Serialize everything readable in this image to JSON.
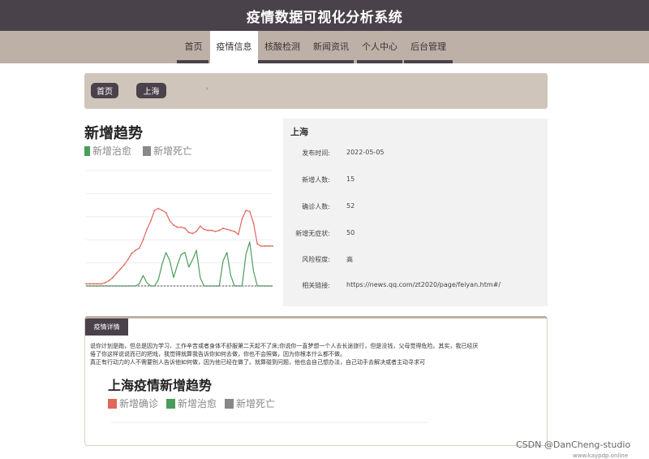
{
  "header": {
    "title": "疫情数据可视化分析系统"
  },
  "nav": {
    "items": [
      {
        "label": "首页"
      },
      {
        "label": "疫情信息"
      },
      {
        "label": "核酸检测"
      },
      {
        "label": "新闻资讯"
      },
      {
        "label": "个人中心"
      },
      {
        "label": "后台管理"
      }
    ],
    "active": "疫情信息"
  },
  "breadcrumb": {
    "home": "首页",
    "current": "上海"
  },
  "trend": {
    "title": "新增趋势",
    "legend": [
      {
        "name": "新增治愈",
        "color": "#4a9e5c"
      },
      {
        "name": "新增死亡",
        "color": "#888888"
      }
    ]
  },
  "info": {
    "city": "上海",
    "rows": [
      {
        "label": "发布时间:",
        "value": "2022-05-05"
      },
      {
        "label": "新增人数:",
        "value": "15"
      },
      {
        "label": "确诊人数:",
        "value": "52"
      },
      {
        "label": "新增无症状:",
        "value": "50"
      },
      {
        "label": "风险程度:",
        "value": "高"
      },
      {
        "label": "相关链接:",
        "value": "https://news.qq.com/zt2020/page/feiyan.htm#/"
      }
    ]
  },
  "detail": {
    "tab": "疫情详情",
    "lines": [
      "说你计划是跑，但总是因为学习、工作辛苦或者身体不舒服第二天起不了床;你说你一直梦想一个人去长途旅行，但是没钱，父母觉得危险。其实，我已经厌",
      "倦了你这样说说而已的把戏，我觉得就算我告诉你如何去做，你也不会照做，因为你根本什么都不做。",
      "真正有行动力的人不需要别人告诉他如何做，因为他已经在做了。就算碰到问题，他也会自己想办法，自己动手去解决或者主动寻求可"
    ],
    "chart_title": "上海疫情新增趋势",
    "legend": [
      {
        "name": "新增确诊",
        "color": "#e0675a"
      },
      {
        "name": "新增治愈",
        "color": "#4a9e5c"
      },
      {
        "name": "新增死亡",
        "color": "#888888"
      }
    ]
  },
  "colors": {
    "header_bg": "#4a424a",
    "nav_bg": "#bdb0a6",
    "breadcrumb_bg": "#cfc5bb",
    "confirmed": "#e0675a",
    "cured": "#4a9e5c",
    "dead": "#888888"
  },
  "chart_data": [
    {
      "type": "line",
      "title": "新增趋势",
      "x": [
        1,
        2,
        3,
        4,
        5,
        6,
        7,
        8,
        9,
        10,
        11,
        12,
        13,
        14,
        15,
        16,
        17,
        18,
        19,
        20,
        21,
        22,
        23,
        24,
        25,
        26,
        27,
        28,
        29,
        30,
        31,
        32,
        33,
        34,
        35,
        36,
        37,
        38,
        39,
        40,
        41,
        42,
        43,
        44,
        45,
        46,
        47,
        48,
        49,
        50
      ],
      "series": [
        {
          "name": "新增确诊",
          "values": [
            2,
            2,
            2,
            2,
            2,
            3,
            5,
            8,
            12,
            16,
            20,
            25,
            31,
            34,
            36,
            44,
            54,
            62,
            72,
            74,
            72,
            70,
            62,
            58,
            56,
            56,
            55,
            51,
            50,
            52,
            57,
            54,
            53,
            53,
            52,
            53,
            55,
            54,
            53,
            52,
            49,
            64,
            72,
            71,
            60,
            40,
            38,
            38,
            38,
            38
          ]
        },
        {
          "name": "新增治愈",
          "values": [
            0,
            0,
            0,
            0,
            0,
            0,
            0,
            0,
            0,
            0,
            0,
            0,
            0,
            0,
            2,
            10,
            3,
            0,
            0,
            6,
            21,
            32,
            24,
            8,
            20,
            30,
            32,
            18,
            25,
            34,
            8,
            0,
            0,
            0,
            0,
            0,
            24,
            32,
            10,
            0,
            0,
            0,
            30,
            42,
            14,
            0,
            0,
            0,
            0,
            0
          ]
        },
        {
          "name": "新增死亡",
          "values": [
            0,
            0,
            0,
            0,
            0,
            0,
            0,
            0,
            0,
            0,
            0,
            0,
            0,
            0,
            0,
            0,
            0,
            0,
            0,
            0,
            0,
            0,
            0,
            0,
            0,
            0,
            0,
            0,
            0,
            0,
            0,
            0,
            0,
            0,
            0,
            0,
            0,
            0,
            0,
            0,
            0,
            0,
            0,
            0,
            0,
            0,
            0,
            0,
            0,
            0
          ]
        }
      ],
      "ylim": [
        0,
        110
      ]
    }
  ]
}
